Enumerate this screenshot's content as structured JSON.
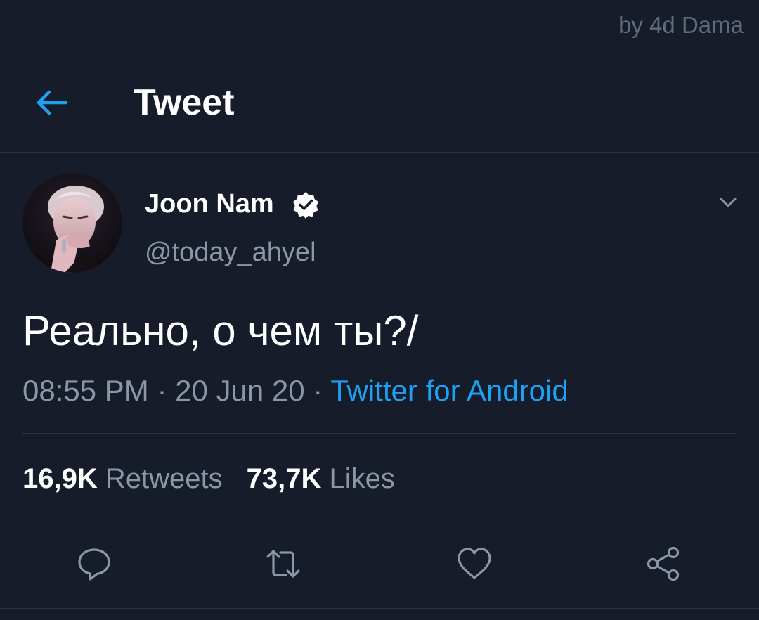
{
  "watermark": "by 4d Dama",
  "header": {
    "back_icon": "arrow-left-icon",
    "title": "Tweet"
  },
  "author": {
    "display_name": "Joon Nam",
    "verified_icon": "verified-badge-icon",
    "handle": "@today_ahyel",
    "menu_icon": "chevron-down-icon"
  },
  "tweet": {
    "text": "Реально, о чем ты?/",
    "time": "08:55 PM",
    "separator": "·",
    "date": "20 Jun 20",
    "source": "Twitter for Android"
  },
  "stats": {
    "retweets_count": "16,9K",
    "retweets_label": "Retweets",
    "likes_count": "73,7K",
    "likes_label": "Likes"
  },
  "actions": [
    {
      "name": "reply",
      "icon": "reply-icon"
    },
    {
      "name": "retweet",
      "icon": "retweet-icon"
    },
    {
      "name": "like",
      "icon": "heart-icon"
    },
    {
      "name": "share",
      "icon": "share-icon"
    }
  ],
  "colors": {
    "background": "#161c29",
    "accent": "#1da1f2",
    "secondary_text": "#8a97a6",
    "divider": "#2b3442"
  }
}
